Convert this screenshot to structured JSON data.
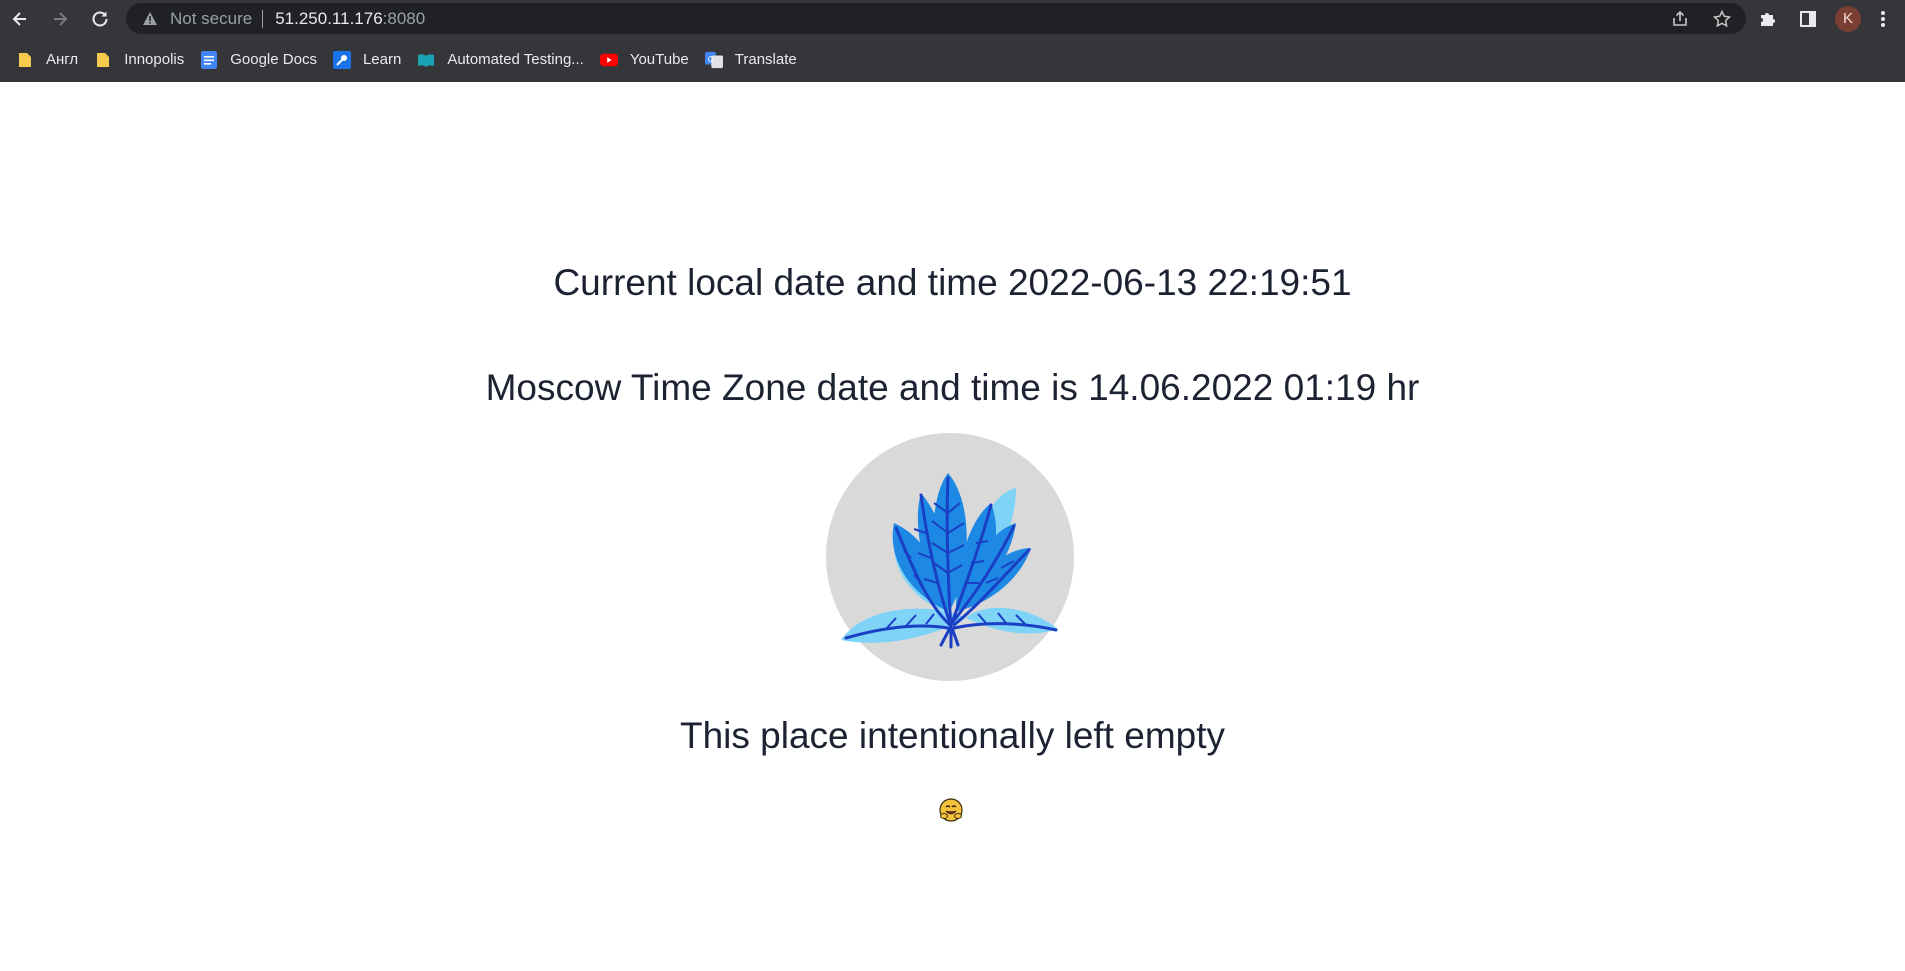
{
  "browser": {
    "security_label": "Not secure",
    "url_host": "51.250.11.176",
    "url_port": ":8080",
    "profile_initial": "K"
  },
  "bookmarks": [
    {
      "label": "Англ",
      "icon": "folder-icon"
    },
    {
      "label": "Innopolis",
      "icon": "folder-icon"
    },
    {
      "label": "Google Docs",
      "icon": "google-docs-icon"
    },
    {
      "label": "Learn",
      "icon": "key-icon"
    },
    {
      "label": "Automated Testing...",
      "icon": "book-icon"
    },
    {
      "label": "YouTube",
      "icon": "youtube-icon"
    },
    {
      "label": "Translate",
      "icon": "google-translate-icon"
    }
  ],
  "page": {
    "local_time_line": "Current local date and time 2022-06-13 22:19:51",
    "moscow_time_line": "Moscow Time Zone date and time is 14.06.2022 01:19 hr",
    "empty_line": "This place intentionally left empty",
    "image": "blue-plant-illustration",
    "emoji": "hugging-face-emoji"
  },
  "colors": {
    "toolbar_bg": "#35363a",
    "omnibox_bg": "#202124",
    "heading_text": "#1c2232",
    "circle_bg": "#d9d9d9",
    "leaf_dark": "#1a3fc4",
    "leaf_mid": "#1e88e5",
    "leaf_light": "#7fd3f7"
  }
}
